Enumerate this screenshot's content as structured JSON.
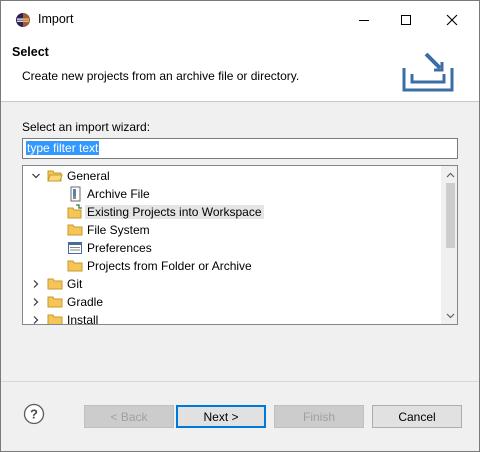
{
  "window": {
    "title": "Import"
  },
  "banner": {
    "title": "Select",
    "description": "Create new projects from an archive file or directory."
  },
  "wizard": {
    "label": "Select an import wizard:",
    "filter_value": "type filter text"
  },
  "tree": {
    "items": [
      {
        "label": "General",
        "level": 0,
        "expanded": true,
        "icon": "folder-open-icon"
      },
      {
        "label": "Archive File",
        "level": 1,
        "icon": "archive-file-icon"
      },
      {
        "label": "Existing Projects into Workspace",
        "level": 1,
        "icon": "existing-projects-icon",
        "selected": true
      },
      {
        "label": "File System",
        "level": 1,
        "icon": "folder-icon"
      },
      {
        "label": "Preferences",
        "level": 1,
        "icon": "preferences-icon"
      },
      {
        "label": "Projects from Folder or Archive",
        "level": 1,
        "icon": "folder-icon"
      },
      {
        "label": "Git",
        "level": 0,
        "expanded": false,
        "icon": "folder-icon"
      },
      {
        "label": "Gradle",
        "level": 0,
        "expanded": false,
        "icon": "folder-icon"
      },
      {
        "label": "Install",
        "level": 0,
        "expanded": false,
        "icon": "folder-icon"
      }
    ]
  },
  "buttons": {
    "back": "< Back",
    "next": "Next >",
    "finish": "Finish",
    "cancel": "Cancel"
  },
  "colors": {
    "selection_blue": "#3399ff",
    "folder_yellow": "#f5c557",
    "default_button_border": "#0078d7"
  }
}
